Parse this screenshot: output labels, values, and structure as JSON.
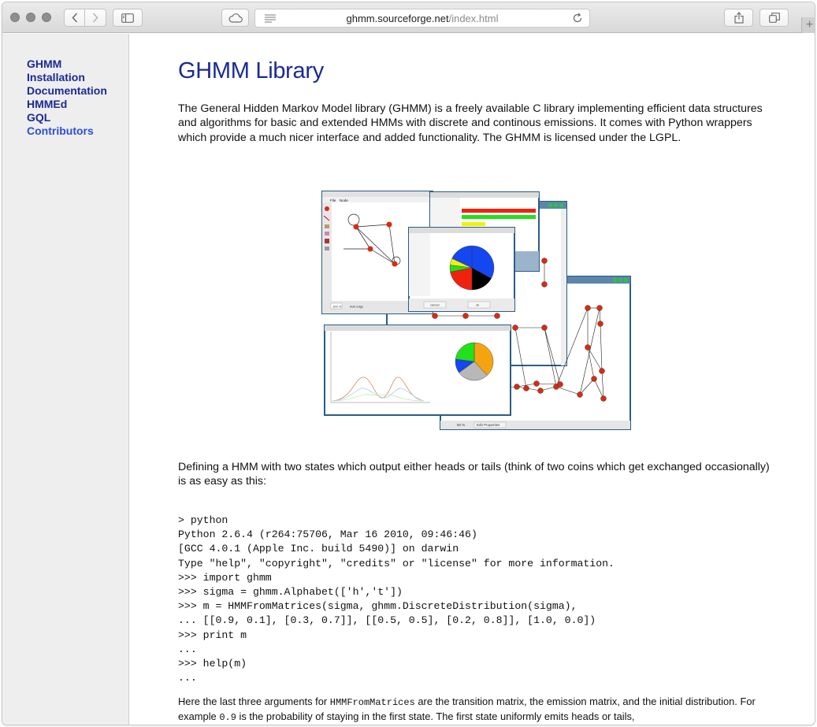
{
  "browser": {
    "url_host": "ghmm.sourceforge.net",
    "url_path": "/index.html"
  },
  "sidebar": {
    "items": [
      {
        "label": "GHMM"
      },
      {
        "label": "Installation"
      },
      {
        "label": "Documentation"
      },
      {
        "label": "HMMEd"
      },
      {
        "label": "GQL"
      },
      {
        "label": "Contributors"
      }
    ]
  },
  "page": {
    "title": "GHMM Library",
    "intro": "The General Hidden Markov Model library (GHMM) is a freely available C library implementing efficient data structures and algorithms for basic and extended HMMs with discrete and continous emissions. It comes with Python wrappers which provide a much nicer interface and added functionality. The GHMM is licensed under the LGPL.",
    "definition_text": "Defining a HMM with two states which output either heads or tails (think of two coins which get exchanged occasionally) is as easy as this:",
    "code_lines": [
      "> python",
      "Python 2.6.4 (r264:75706, Mar 16 2010, 09:46:46)",
      "[GCC 4.0.1 (Apple Inc. build 5490)] on darwin",
      "Type \"help\", \"copyright\", \"credits\" or \"license\" for more information.",
      ">>> import ghmm",
      ">>> sigma = ghmm.Alphabet(['h','t'])",
      ">>> m = HMMFromMatrices(sigma, ghmm.DiscreteDistribution(sigma),",
      "... [[0.9, 0.1], [0.3, 0.7]], [[0.5, 0.5], [0.2, 0.8]], [1.0, 0.0])",
      ">>> print m",
      "...",
      ">>> help(m)",
      "..."
    ],
    "last_para": {
      "t1": "Here the last three arguments for ",
      "c1": "HMMFromMatrices",
      "t2": " are the transition matrix, the emission matrix, and the initial distribution. For example ",
      "c2": "0.9",
      "t3": " is the probability of staying in the first state. The first state uniformly emits heads or tails,"
    }
  },
  "screenshot_panels": {
    "top_left_menu": [
      "File",
      "Node"
    ],
    "dialog_buttons": [
      "cancel",
      "ok"
    ],
    "status_left": "100 %",
    "status_left_btn": "Add edge",
    "status_right": "50 %",
    "status_right_btn": "Edit Properties"
  },
  "colors": {
    "nav_link": "#1a2a94",
    "nav_active": "#2a4fd6",
    "title": "#1a2a94",
    "sidebar_bg": "#eeeeee",
    "pie_blue": "#1447f0",
    "pie_black": "#000000",
    "pie_red": "#f0210f",
    "pie_green": "#22e01a",
    "pie_yellow": "#f0f010",
    "pie_orange": "#f5a411",
    "pie_gray": "#b8b8b8",
    "node_red": "#d92b10"
  }
}
